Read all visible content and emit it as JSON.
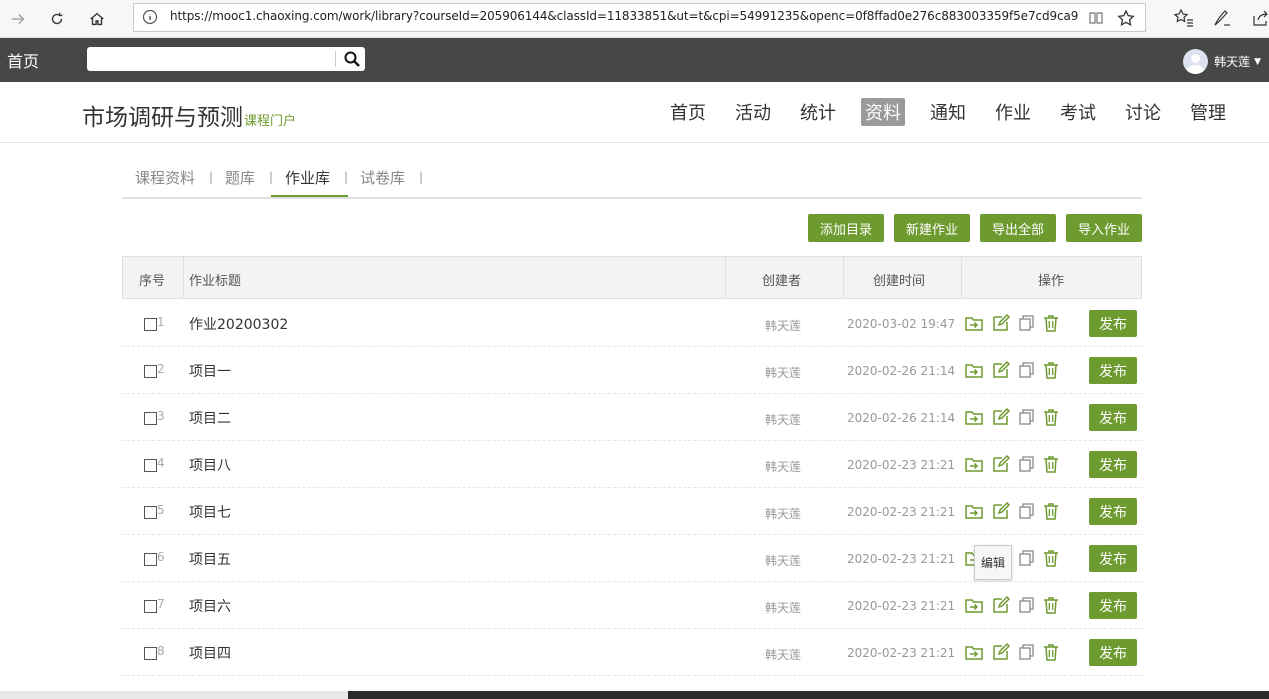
{
  "browser": {
    "url": "https://mooc1.chaoxing.com/work/library?courseId=205906144&classId=11833851&ut=t&cpi=54991235&openc=0f8ffad0e276c883003359f5e7cd9ca9"
  },
  "topbar": {
    "home_label": "首页",
    "search_placeholder": "",
    "user_name": "韩天莲"
  },
  "course": {
    "title": "市场调研与预测",
    "portal_label": "课程门户",
    "nav": [
      "首页",
      "活动",
      "统计",
      "资料",
      "通知",
      "作业",
      "考试",
      "讨论",
      "管理"
    ],
    "active_nav": "资料"
  },
  "subtabs": {
    "items": [
      "课程资料",
      "题库",
      "作业库",
      "试卷库"
    ],
    "active": "作业库"
  },
  "actions": {
    "add_catalog": "添加目录",
    "new_homework": "新建作业",
    "export_all": "导出全部",
    "import_homework": "导入作业"
  },
  "table": {
    "headers": {
      "index": "序号",
      "title": "作业标题",
      "creator": "创建者",
      "created_time": "创建时间",
      "operation": "操作"
    },
    "publish_label": "发布",
    "tooltip": "编辑",
    "rows": [
      {
        "index": "1",
        "title": "作业20200302",
        "creator": "韩天莲",
        "time": "2020-03-02 19:47"
      },
      {
        "index": "2",
        "title": "项目一",
        "creator": "韩天莲",
        "time": "2020-02-26 21:14"
      },
      {
        "index": "3",
        "title": "项目二",
        "creator": "韩天莲",
        "time": "2020-02-26 21:14"
      },
      {
        "index": "4",
        "title": "项目八",
        "creator": "韩天莲",
        "time": "2020-02-23 21:21"
      },
      {
        "index": "5",
        "title": "项目七",
        "creator": "韩天莲",
        "time": "2020-02-23 21:21"
      },
      {
        "index": "6",
        "title": "项目五",
        "creator": "韩天莲",
        "time": "2020-02-23 21:21"
      },
      {
        "index": "7",
        "title": "项目六",
        "creator": "韩天莲",
        "time": "2020-02-23 21:21"
      },
      {
        "index": "8",
        "title": "项目四",
        "creator": "韩天莲",
        "time": "2020-02-23 21:21"
      }
    ]
  },
  "colors": {
    "accent": "#6e9b2f",
    "topbar": "#474747",
    "active_nav_bg": "#9a9a9a"
  }
}
